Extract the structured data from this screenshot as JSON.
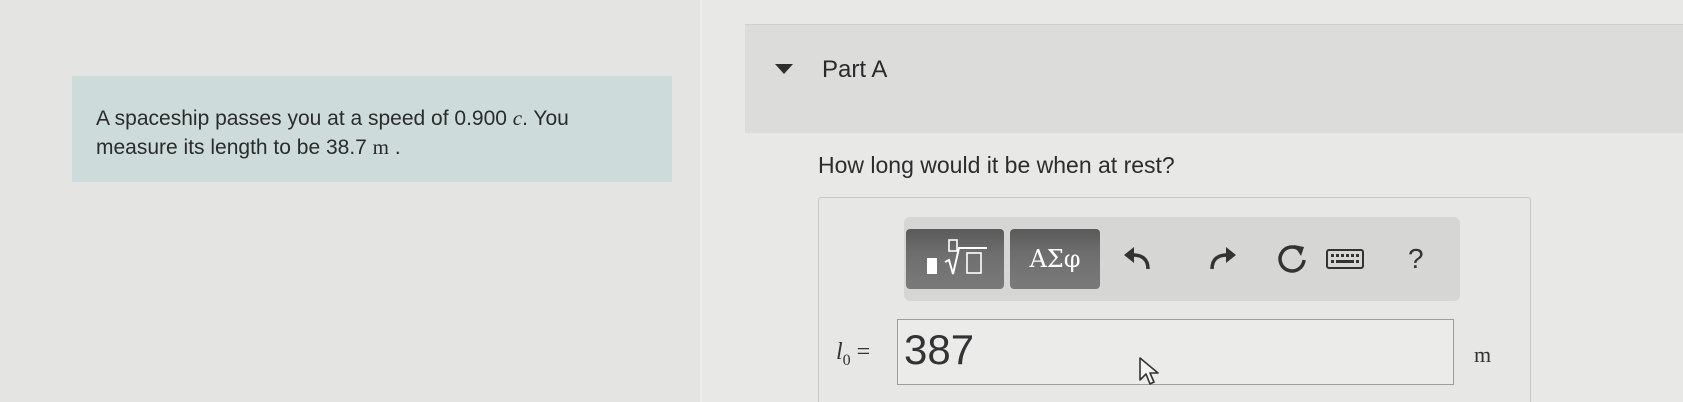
{
  "problem": {
    "line1_prefix": "A spaceship passes you at a speed of 0.900 ",
    "speed_var": "c",
    "line1_suffix": ". You",
    "line2_prefix": "measure its length to be 38.7 ",
    "length_unit": "m",
    "line2_suffix": " ."
  },
  "part": {
    "title": "Part A",
    "question": "How long would it be when at rest?"
  },
  "toolbar": {
    "symbols_label": "ΑΣφ",
    "help_label": "?",
    "icons": [
      "templates-icon",
      "undo-icon",
      "redo-icon",
      "reset-icon",
      "keyboard-icon"
    ]
  },
  "answer": {
    "variable": "l",
    "subscript": "0",
    "equals": "=",
    "value": "387",
    "unit": "m"
  }
}
